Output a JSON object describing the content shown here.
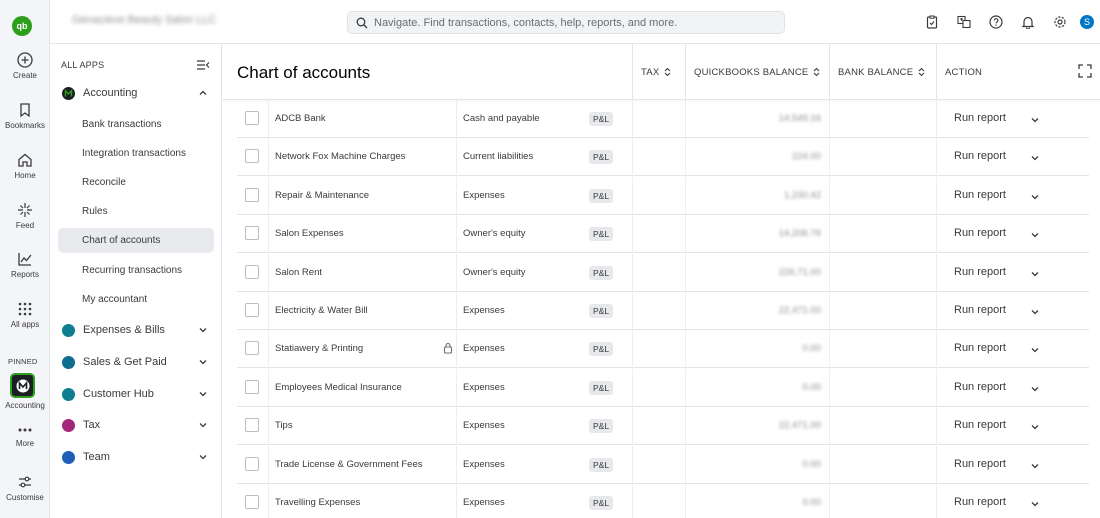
{
  "topbar": {
    "company_name": "Genacieve Beauty Salon LLC",
    "search_placeholder": "Navigate. Find transactions, contacts, help, reports, and more.",
    "avatar_initial": "S",
    "icons": [
      "clipboard-icon",
      "translate-icon",
      "help-icon",
      "bell-icon",
      "gear-icon"
    ]
  },
  "rail": {
    "logo": "qb",
    "items": [
      {
        "label": "Create",
        "icon": "plus-circle-icon"
      },
      {
        "label": "Bookmarks",
        "icon": "bookmark-icon"
      },
      {
        "label": "Home",
        "icon": "home-icon"
      },
      {
        "label": "Feed",
        "icon": "sparkle-icon"
      },
      {
        "label": "Reports",
        "icon": "chart-icon"
      },
      {
        "label": "All apps",
        "icon": "grid-icon"
      }
    ],
    "pinned_label": "PINNED",
    "pinned_item": "Accounting",
    "more_label": "More",
    "customise_label": "Customise"
  },
  "nav": {
    "all_apps_label": "ALL APPS",
    "accounting": {
      "label": "Accounting",
      "subitems": [
        "Bank transactions",
        "Integration transactions",
        "Reconcile",
        "Rules",
        "Chart of accounts",
        "Recurring transactions",
        "My accountant"
      ],
      "active": "Chart of accounts"
    },
    "groups": [
      {
        "label": "Expenses & Bills",
        "color": "#0d7f8f"
      },
      {
        "label": "Sales & Get Paid",
        "color": "#0d6e8f"
      },
      {
        "label": "Customer Hub",
        "color": "#0d7f8f"
      },
      {
        "label": "Tax",
        "color": "#a3277a"
      },
      {
        "label": "Team",
        "color": "#1f5fb8"
      }
    ]
  },
  "main": {
    "title": "Chart of accounts",
    "columns": {
      "tax": "TAX",
      "qb_balance": "QUICKBOOKS BALANCE",
      "bank_balance": "BANK BALANCE",
      "action": "ACTION"
    },
    "rows": [
      {
        "name": "ADCB Bank",
        "type": "Cash and payable",
        "badge": "P&L",
        "qb_balance": "14,549.16",
        "locked": false
      },
      {
        "name": "Network Fox Machine Charges",
        "type": "Current liabilities",
        "badge": "P&L",
        "qb_balance": "224.00",
        "locked": false
      },
      {
        "name": "Repair & Maintenance",
        "type": "Expenses",
        "badge": "P&L",
        "qb_balance": "1,230.42",
        "locked": false
      },
      {
        "name": "Salon Expenses",
        "type": "Owner's equity",
        "badge": "P&L",
        "qb_balance": "14,206.76",
        "locked": false
      },
      {
        "name": "Salon Rent",
        "type": "Owner's equity",
        "badge": "P&L",
        "qb_balance": "226,71.00",
        "locked": false
      },
      {
        "name": "Electricity & Water Bill",
        "type": "Expenses",
        "badge": "P&L",
        "qb_balance": "22,471.00",
        "locked": false
      },
      {
        "name": "Statiawery & Printing",
        "type": "Expenses",
        "badge": "P&L",
        "qb_balance": "0.00",
        "locked": true
      },
      {
        "name": "Employees Medical Insurance",
        "type": "Expenses",
        "badge": "P&L",
        "qb_balance": "0.00",
        "locked": false
      },
      {
        "name": "Tips",
        "type": "Expenses",
        "badge": "P&L",
        "qb_balance": "22,471.00",
        "locked": false
      },
      {
        "name": "Trade License & Government Fees",
        "type": "Expenses",
        "badge": "P&L",
        "qb_balance": "0.00",
        "locked": false
      },
      {
        "name": "Travelling Expenses",
        "type": "Expenses",
        "badge": "P&L",
        "qb_balance": "0.00",
        "locked": false
      }
    ],
    "action_label": "Run report"
  },
  "colors": {
    "brand_green": "#2ca01c",
    "active_nav_bg": "#e9eaed",
    "avatar_blue": "#0077c5"
  }
}
